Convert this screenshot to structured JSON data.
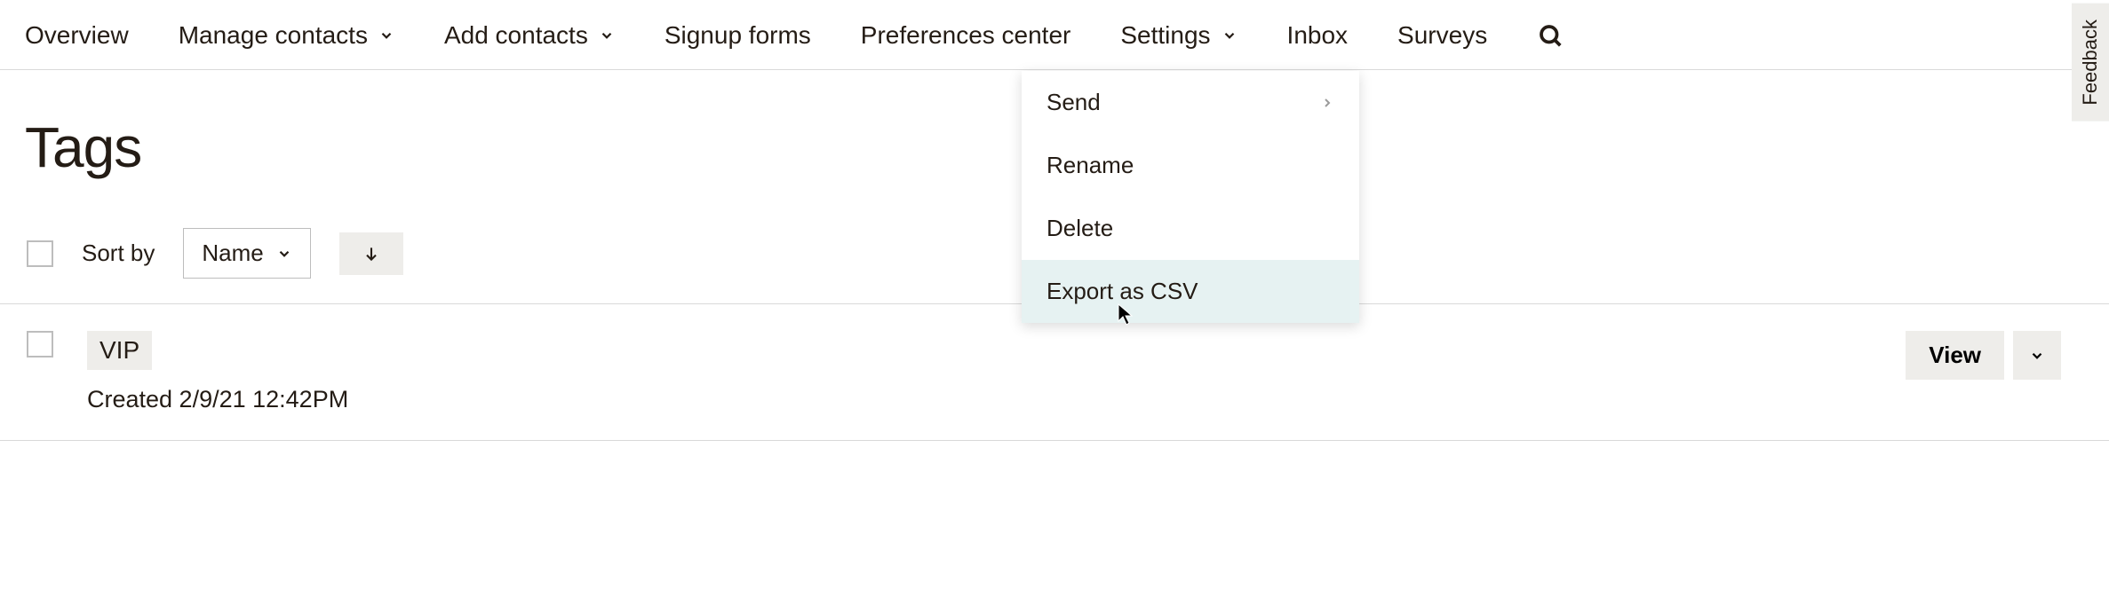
{
  "nav": {
    "overview": "Overview",
    "manage_contacts": "Manage contacts",
    "add_contacts": "Add contacts",
    "signup_forms": "Signup forms",
    "preferences_center": "Preferences center",
    "settings": "Settings",
    "inbox": "Inbox",
    "surveys": "Surveys"
  },
  "page_title": "Tags",
  "sort": {
    "label": "Sort by",
    "selected": "Name"
  },
  "tags": [
    {
      "name": "VIP",
      "created": "Created 2/9/21 12:42PM",
      "view_label": "View"
    }
  ],
  "dropdown": {
    "send": "Send",
    "rename": "Rename",
    "delete": "Delete",
    "export_csv": "Export as CSV"
  },
  "feedback": "Feedback"
}
